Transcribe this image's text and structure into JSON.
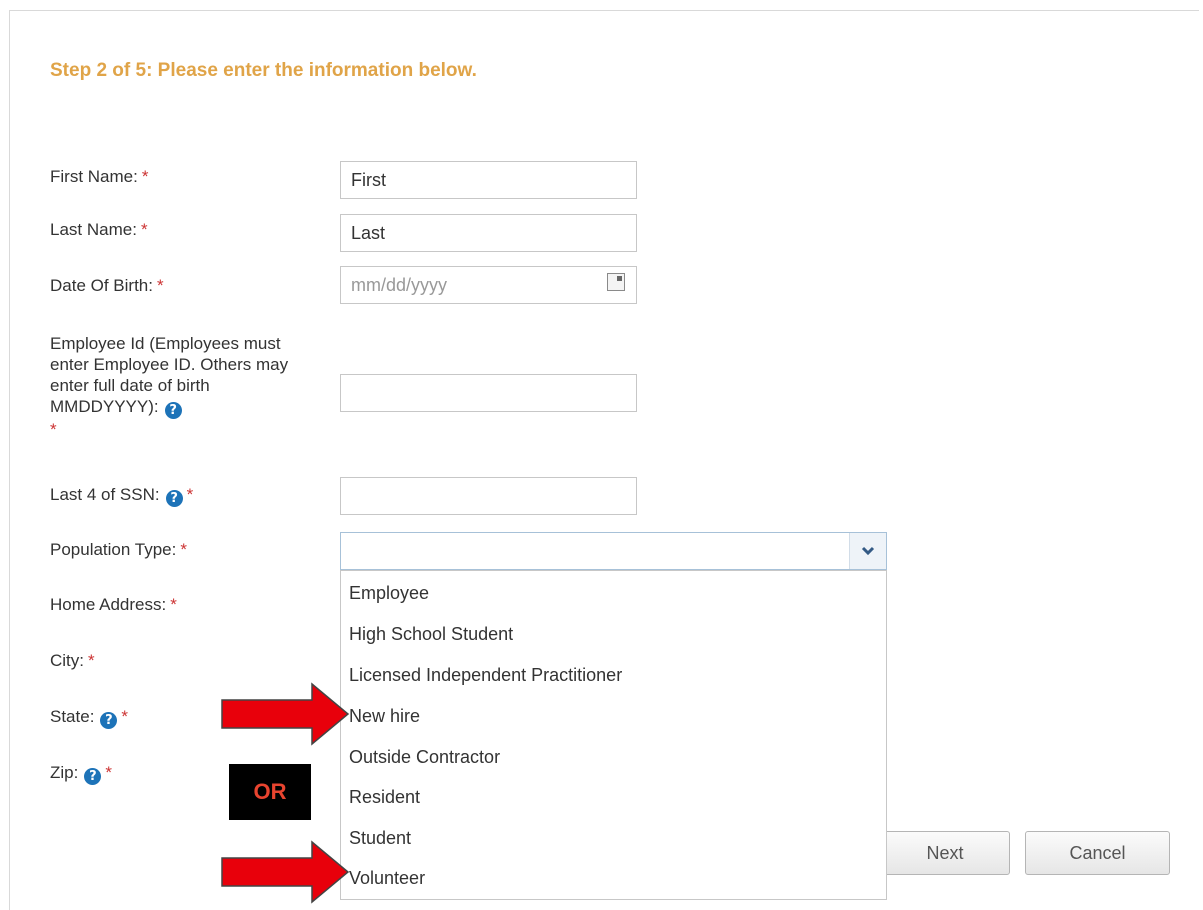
{
  "header": {
    "step_title": "Step 2 of 5: Please enter the information below."
  },
  "form": {
    "required_mark": "*",
    "help_glyph": "?",
    "first_name": {
      "label": "First Name:",
      "value": "First"
    },
    "last_name": {
      "label": "Last Name:",
      "value": "Last"
    },
    "dob": {
      "label": "Date Of Birth:",
      "placeholder": "mm/dd/yyyy"
    },
    "employee_id": {
      "label": "Employee Id (Employees must enter Employee ID. Others may enter full date of birth MMDDYYYY):",
      "value": ""
    },
    "ssn": {
      "label": "Last 4 of SSN:",
      "value": ""
    },
    "population": {
      "label": "Population Type:",
      "selected": "",
      "options": [
        "Employee",
        "High School Student",
        "Licensed Independent Practitioner",
        "New hire",
        "Outside Contractor",
        "Resident",
        "Student",
        "Volunteer"
      ]
    },
    "home_address": {
      "label": "Home Address:"
    },
    "city": {
      "label": "City:"
    },
    "state": {
      "label": "State:"
    },
    "zip": {
      "label": "Zip:"
    }
  },
  "buttons": {
    "next": "Next",
    "cancel": "Cancel"
  },
  "annotation": {
    "or_text": "OR",
    "arrow_color": "#e8000b"
  },
  "colors": {
    "title": "#e0a448",
    "required": "#cc3333",
    "help_icon": "#1d73b8"
  },
  "icons": {
    "help": "help-icon",
    "calendar": "calendar-icon",
    "dropdown": "chevron-down-icon",
    "arrow": "right-arrow-icon"
  }
}
